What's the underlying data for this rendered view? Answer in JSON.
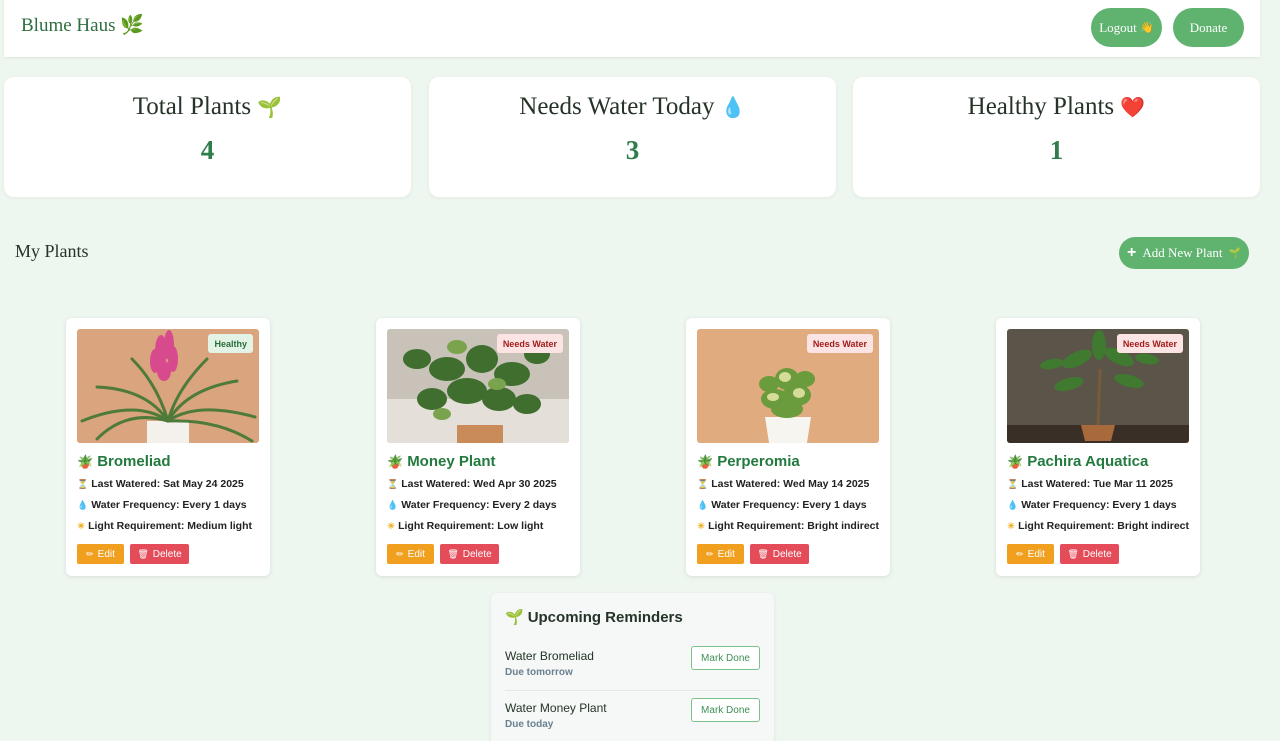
{
  "header": {
    "brand": "Blume Haus",
    "brand_icon": "🌿",
    "logout_label": "Logout",
    "logout_icon": "👋",
    "donate_label": "Donate"
  },
  "stats": [
    {
      "label": "Total Plants",
      "icon": "🌱",
      "value": "4"
    },
    {
      "label": "Needs Water Today",
      "icon": "💧",
      "value": "3"
    },
    {
      "label": "Healthy Plants",
      "icon": "❤️",
      "value": "1"
    }
  ],
  "section": {
    "title": "My Plants",
    "add_label": "Add New Plant",
    "add_icon": "🌱"
  },
  "plants": [
    {
      "name": "Bromeliad",
      "status": "Healthy",
      "last_watered": "Last Watered: Sat May 24 2025",
      "frequency": "Water Frequency: Every 1 days",
      "light": "Light Requirement: Medium light"
    },
    {
      "name": "Money Plant",
      "status": "Needs Water",
      "last_watered": "Last Watered: Wed Apr 30 2025",
      "frequency": "Water Frequency: Every 2 days",
      "light": "Light Requirement: Low light"
    },
    {
      "name": "Perperomia",
      "status": "Needs Water",
      "last_watered": "Last Watered: Wed May 14 2025",
      "frequency": "Water Frequency: Every 1 days",
      "light": "Light Requirement: Bright indirect"
    },
    {
      "name": "Pachira Aquatica",
      "status": "Needs Water",
      "last_watered": "Last Watered: Tue Mar 11 2025",
      "frequency": "Water Frequency: Every 1 days",
      "light": "Light Requirement: Bright indirect"
    }
  ],
  "card_buttons": {
    "edit": "Edit",
    "delete": "Delete"
  },
  "reminders": {
    "title": "Upcoming Reminders",
    "items": [
      {
        "task": "Water Bromeliad",
        "due": "Due tomorrow",
        "action": "Mark Done"
      },
      {
        "task": "Water Money Plant",
        "due": "Due today",
        "action": "Mark Done"
      }
    ]
  },
  "colors": {
    "accent": "#5fb36f",
    "plant_name": "#237a3e",
    "edit": "#f0a01e",
    "delete": "#e44c5a",
    "background": "#eef7ef"
  }
}
